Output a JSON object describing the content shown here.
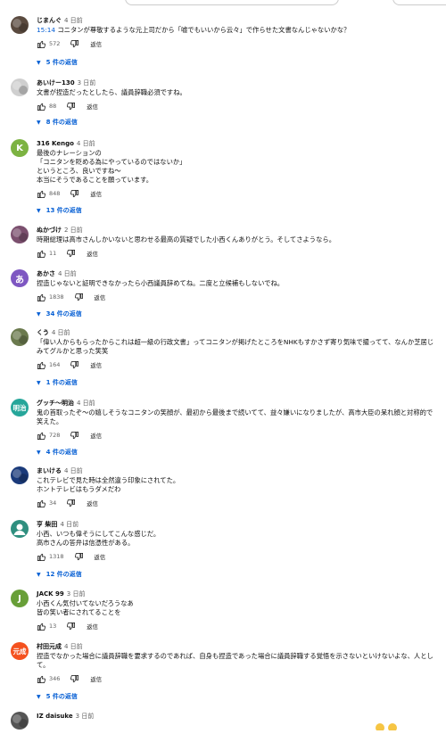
{
  "labels": {
    "reply": "返信"
  },
  "comments": [
    {
      "author": "じまんぐ",
      "time": "4 日前",
      "avatar_type": "photo",
      "avatar_color": "#5a4a3f",
      "timestamp_link": "15:14",
      "text": " コニタンが尊敬するような元上司だから「嘘でもいいから云々」で作らせた文書なんじゃないかな？",
      "likes": "572",
      "replies": "5 件の返信"
    },
    {
      "author": "あいけー130",
      "time": "3 日前",
      "avatar_type": "photo",
      "avatar_color": "#cfcfcf",
      "text": "文書が捏造だったとしたら、議員辞職必須ですね。",
      "likes": "88",
      "replies": "8 件の返信"
    },
    {
      "author": "316 Kengo",
      "time": "4 日前",
      "avatar_type": "letter",
      "avatar_letter": "K",
      "avatar_color": "#7cb342",
      "text": "最後のナレーションの\n「コニタンを貶める為にやっているのではないか」\nというところ、良いですね〜\n本当にそうであることを願っています。",
      "likes": "848",
      "replies": "13 件の返信"
    },
    {
      "author": "ぬかづけ",
      "time": "2 日前",
      "avatar_type": "photo",
      "avatar_color": "#7b4f6e",
      "text": "時期総理は高市さんしかいないと思わせる最高の質疑でした小西くんありがとう。そしてさようなら。",
      "likes": "11",
      "replies": ""
    },
    {
      "author": "あかさ",
      "time": "4 日前",
      "avatar_type": "letter",
      "avatar_letter": "あ",
      "avatar_color": "#7e57c2",
      "text": "捏造じゃないと証明できなかったら小西議員辞めてね。二度と立候補もしないでね。",
      "likes": "1838",
      "replies": "34 件の返信"
    },
    {
      "author": "くう",
      "time": "4 日前",
      "avatar_type": "photo",
      "avatar_color": "#6b7a4e",
      "text": "「偉い人からもらったからこれは超一級の行政文書」ってコニタンが掲げたところをNHKもすかさず寄り気味で撮ってて、なんか芝居じみてグルかと思った笑笑",
      "likes": "164",
      "replies": "1 件の返信"
    },
    {
      "author": "グッチ〜明治",
      "time": "4 日前",
      "avatar_type": "letter",
      "avatar_letter": "明治",
      "avatar_color": "#26a69a",
      "text": "鬼の首取ったぞ〜の嬉しそうなコニタンの笑顔が、最初から最後まで続いてて、益々嫌いになりましたが、高市大臣の呆れ顔と対称的で笑えた。",
      "likes": "728",
      "replies": "4 件の返信"
    },
    {
      "author": "まいける",
      "time": "4 日前",
      "avatar_type": "photo",
      "avatar_color": "#1a3a7a",
      "text": "これテレビで見た時は全然違う印象にされてた。\nホントテレビはもうダメだわ",
      "likes": "34",
      "replies": ""
    },
    {
      "author": "亨 柴田",
      "time": "4 日前",
      "avatar_type": "person",
      "avatar_color": "#2f8f7f",
      "text": "小西、いつも偉そうにしてこんな感じだ。\n高市さんの答弁は信憑性がある。",
      "likes": "1318",
      "replies": "12 件の返信"
    },
    {
      "author": "JACK 99",
      "time": "3 日前",
      "avatar_type": "letter",
      "avatar_letter": "J",
      "avatar_color": "#689f38",
      "text": "小西くん気付いてないだろうなあ\n皆の笑い者にされてることを",
      "likes": "13",
      "replies": ""
    },
    {
      "author": "村田元成",
      "time": "4 日前",
      "avatar_type": "letter",
      "avatar_letter": "元成",
      "avatar_color": "#f4511e",
      "text": "捏造でなかった場合に議員辞職を要求するのであれば、自身も捏造であった場合に議員辞職する覚悟を示さないといけないよな、人として。",
      "likes": "346",
      "replies": "5 件の返信"
    },
    {
      "author": "IZ daisuke",
      "time": "3 日前",
      "avatar_type": "photo",
      "avatar_color": "#555555",
      "text": "",
      "likes": "",
      "replies": ""
    }
  ]
}
